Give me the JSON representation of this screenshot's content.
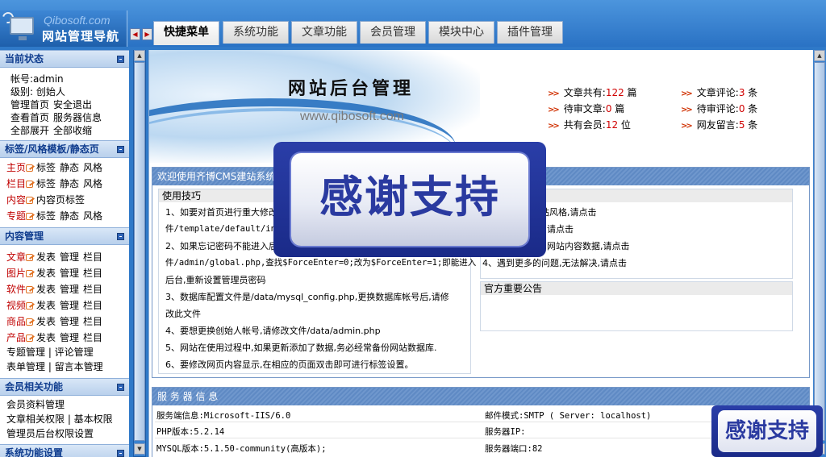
{
  "header": {
    "domain": "Qibosoft.com",
    "title": "网站管理导航",
    "tabs": [
      "快捷菜单",
      "系统功能",
      "文章功能",
      "会员管理",
      "模块中心",
      "插件管理"
    ],
    "active_tab": 0
  },
  "sidebar": {
    "status": {
      "title": "当前状态",
      "account_label": "帐号:",
      "account": "admin",
      "level": "级别: 创始人",
      "links": [
        [
          "管理首页",
          "安全退出"
        ],
        [
          "查看首页",
          "服务器信息"
        ],
        [
          "全部展开",
          "全部收缩"
        ]
      ]
    },
    "templates": {
      "title": "标签/风格模板/静态页",
      "rows": [
        {
          "name": "主页",
          "actions": [
            "标签",
            "静态",
            "风格"
          ]
        },
        {
          "name": "栏目",
          "actions": [
            "标签",
            "静态",
            "风格"
          ]
        },
        {
          "name": "内容",
          "actions": [
            "内容页标签"
          ]
        },
        {
          "name": "专题",
          "actions": [
            "标签",
            "静态",
            "风格"
          ]
        }
      ]
    },
    "content": {
      "title": "内容管理",
      "rows": [
        {
          "name": "文章",
          "actions": [
            "发表",
            "管理",
            "栏目"
          ]
        },
        {
          "name": "图片",
          "actions": [
            "发表",
            "管理",
            "栏目"
          ]
        },
        {
          "name": "软件",
          "actions": [
            "发表",
            "管理",
            "栏目"
          ]
        },
        {
          "name": "视频",
          "actions": [
            "发表",
            "管理",
            "栏目"
          ]
        },
        {
          "name": "商品",
          "actions": [
            "发表",
            "管理",
            "栏目"
          ]
        },
        {
          "name": "产品",
          "actions": [
            "发表",
            "管理",
            "栏目"
          ]
        }
      ],
      "extra": [
        "专题管理 | 评论管理",
        "表单管理 | 留言本管理"
      ]
    },
    "member": {
      "title": "会员相关功能",
      "rows": [
        "会员资料管理",
        "文章相关权限 | 基本权限",
        "管理员后台权限设置"
      ]
    },
    "system": {
      "title": "系统功能设置"
    }
  },
  "banner": {
    "title": "网站后台管理",
    "url": "www.qibosoft.com",
    "stats": [
      {
        "label": "文章共有:",
        "value": "122",
        "unit": "篇"
      },
      {
        "label": "文章评论:",
        "value": "3",
        "unit": "条"
      },
      {
        "label": "待审文章:",
        "value": "0",
        "unit": "篇"
      },
      {
        "label": "待审评论:",
        "value": "0",
        "unit": "条"
      },
      {
        "label": "共有会员:",
        "value": "12",
        "unit": "位"
      },
      {
        "label": "网友留言:",
        "value": "5",
        "unit": "条"
      }
    ]
  },
  "welcome": {
    "title": "欢迎使用齐博CMS建站系统",
    "tips_title": "使用技巧",
    "tips": [
      "1、如要对首页进行重大修改",
      "件/template/default/inde",
      "2、如果忘记密码不能进入后",
      "件/admin/global.php,查找$ForceEnter=0;改为$ForceEnter=1;即能进入",
      "后台,重新设置管理员密码",
      "3、数据库配置文件是/data/mysql_config.php,更换数据库帐号后,请修",
      "改此文件",
      "4、要想更换创始人帐号,请修改文件/data/admin.php",
      "5、网站在使用过程中,如果更新添加了数据,务必经常备份网站数据库.",
      "6、要修改网页内容显示,在相应的页面双击即可进行标签设置。"
    ],
    "right_lines": [
      "的网站风格,请点击",
      "请点击",
      "网站内容数据,请点击",
      "4、遇到更多的问题,无法解决,请点击"
    ],
    "notice_title": "官方重要公告"
  },
  "server": {
    "title": "服 务 器 信 息",
    "left": [
      "服务端信息:Microsoft-IIS/6.0",
      "PHP版本:5.2.14",
      "MYSQL版本:5.1.50-community(高版本);"
    ],
    "right": [
      "邮件模式:SMTP ( Server: localhost)",
      "服务器IP:",
      "服务器端口:82"
    ]
  },
  "overlay": {
    "text": "感谢支持",
    "text_small": "感谢支持"
  },
  "colors": {
    "accent": "#2f79c8",
    "link_red": "#c00000",
    "panel_head": "#6f97cd"
  }
}
